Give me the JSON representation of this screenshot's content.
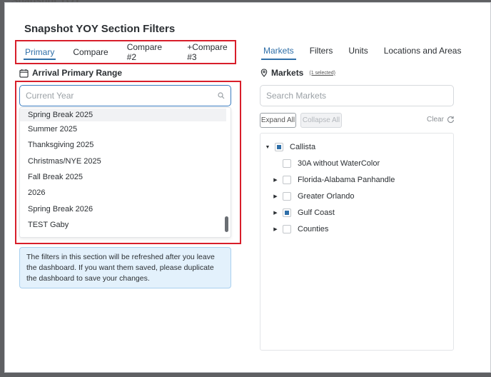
{
  "modal": {
    "backdrop_title": "Snapshot YOY",
    "title": "Snapshot YOY Section Filters"
  },
  "tabs_left": [
    {
      "label": "Primary",
      "active": true
    },
    {
      "label": "Compare",
      "active": false
    },
    {
      "label": "Compare #2",
      "active": false
    },
    {
      "label": "+Compare #3",
      "active": false
    }
  ],
  "tabs_right": [
    {
      "label": "Markets",
      "active": true
    },
    {
      "label": "Filters",
      "active": false
    },
    {
      "label": "Units",
      "active": false
    },
    {
      "label": "Locations and Areas",
      "active": false
    }
  ],
  "arrival": {
    "label": "Arrival Primary Range",
    "icon": "calendar-icon",
    "search_placeholder": "Current Year",
    "options": [
      "Spring Break 2025",
      "Summer 2025",
      "Thanksgiving 2025",
      "Christmas/NYE 2025",
      "Fall Break 2025",
      "2026",
      "Spring Break 2026",
      "TEST Gaby"
    ]
  },
  "info": {
    "text": "The filters in this section will be refreshed after you leave the dashboard. If you want them saved, please duplicate the dashboard to save your changes."
  },
  "markets": {
    "label": "Markets",
    "selected_badge": "(1 selected)",
    "search_placeholder": "Search Markets",
    "expand_label": "Expand All",
    "collapse_label": "Collapse All",
    "clear_label": "Clear",
    "tree": [
      {
        "label": "Callista",
        "level": 0,
        "caret": "down",
        "state": "partial"
      },
      {
        "label": "30A without WaterColor",
        "level": 1,
        "caret": "none",
        "state": "unchecked"
      },
      {
        "label": "Florida-Alabama Panhandle",
        "level": 1,
        "caret": "right",
        "state": "unchecked"
      },
      {
        "label": "Greater Orlando",
        "level": 1,
        "caret": "right",
        "state": "unchecked"
      },
      {
        "label": "Gulf Coast",
        "level": 1,
        "caret": "right",
        "state": "partial"
      },
      {
        "label": "Counties",
        "level": 1,
        "caret": "right",
        "state": "unchecked"
      }
    ]
  },
  "colors": {
    "accent": "#2f6fa8",
    "highlight_border": "#d81e2a",
    "info_bg": "#e3f1fc"
  }
}
